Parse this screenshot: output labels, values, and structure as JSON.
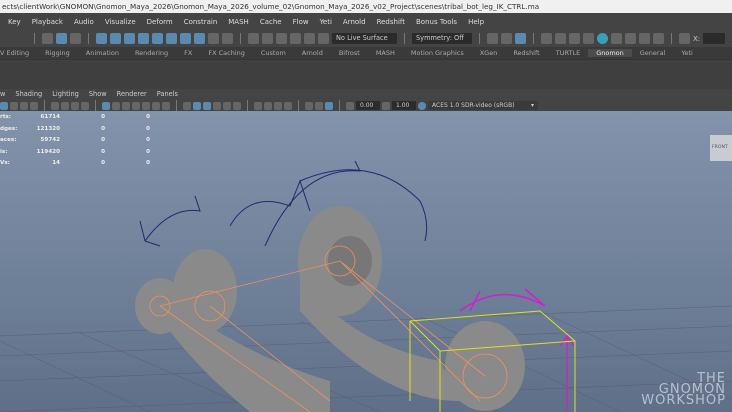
{
  "title": "ects\\clientWork\\GNOMON\\Gnomon_Maya_2026\\Gnomon_Maya_2026_volume_02\\Gnomon_Maya_2026_v02_Project\\scenes\\tribal_bot_leg_IK_CTRL.ma",
  "menu": [
    "Key",
    "Playback",
    "Audio",
    "Visualize",
    "Deform",
    "Constrain",
    "MASH",
    "Cache",
    "Flow",
    "Yeti",
    "Arnold",
    "Redshift",
    "Bonus Tools",
    "Help"
  ],
  "status": {
    "live_surface": "No Live Surface",
    "symmetry": "Symmetry: Off",
    "x_label": "X:"
  },
  "shelf_tabs": [
    "V Editing",
    "Rigging",
    "Animation",
    "Rendering",
    "FX",
    "FX Caching",
    "Custom",
    "Arnold",
    "Bifrost",
    "MASH",
    "Motion Graphics",
    "XGen",
    "Redshift",
    "TURTLE",
    "Gnomon",
    "General",
    "Yeti"
  ],
  "active_shelf": "Gnomon",
  "panel_menu": [
    "w",
    "Shading",
    "Lighting",
    "Show",
    "Renderer",
    "Panels"
  ],
  "panel_tools": {
    "exposure": "0.00",
    "gamma": "1.00",
    "color_space": "ACES 1.0 SDR-video (sRGB)"
  },
  "hud": [
    {
      "label": "rts:",
      "v": "61714",
      "a": "0",
      "b": "0"
    },
    {
      "label": "dges:",
      "v": "121320",
      "a": "0",
      "b": "0"
    },
    {
      "label": "aces:",
      "v": "59742",
      "a": "0",
      "b": "0"
    },
    {
      "label": "is:",
      "v": "119420",
      "a": "0",
      "b": "0"
    },
    {
      "label": "Vs:",
      "v": "14",
      "a": "0",
      "b": "0"
    }
  ],
  "view_cube": "FRONT",
  "watermark": "THE GNOMON WORKSHOP"
}
